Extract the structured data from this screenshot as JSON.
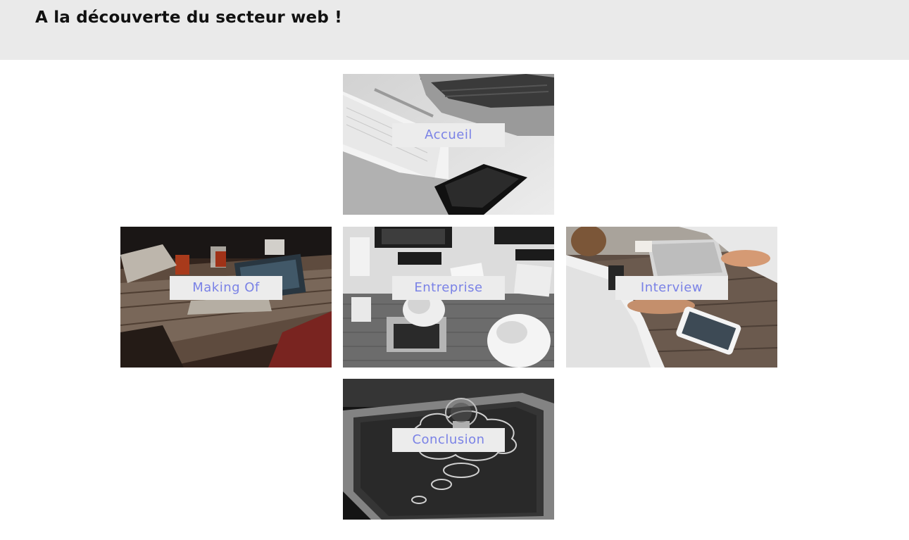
{
  "header": {
    "title": "A la découverte du secteur web !"
  },
  "nav": {
    "tiles": [
      {
        "label": "Accueil",
        "photo": "laptop-notebook-phone-photo"
      },
      {
        "label": "Making Of",
        "photo": "team-meeting-table-photo"
      },
      {
        "label": "Entreprise",
        "photo": "office-desk-overhead-photo"
      },
      {
        "label": "Interview",
        "photo": "cafe-tablet-conversation-photo"
      },
      {
        "label": "Conclusion",
        "photo": "chalkboard-lightbulb-photo"
      }
    ]
  },
  "colors": {
    "header_background": "#eaeaea",
    "label_background": "#ececec",
    "label_text": "#7a82e6",
    "title_text": "#111111"
  }
}
